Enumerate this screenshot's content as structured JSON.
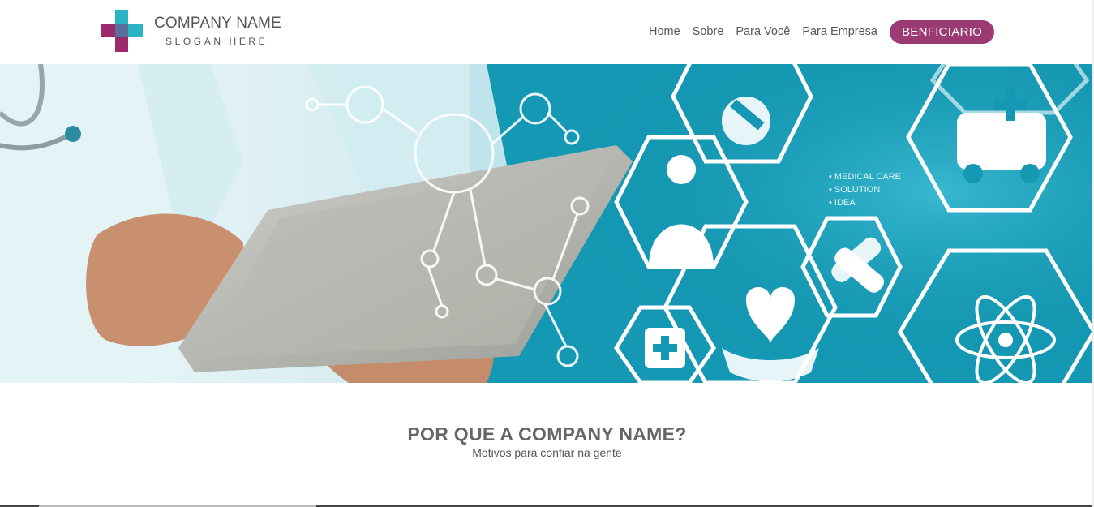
{
  "brand": {
    "name": "COMPANY NAME",
    "slogan": "SLOGAN HERE",
    "colors": {
      "teal": "#2ab3c2",
      "magenta": "#9c2a6c"
    }
  },
  "nav": {
    "items": [
      {
        "label": "Home"
      },
      {
        "label": "Sobre"
      },
      {
        "label": "Para Você"
      },
      {
        "label": "Para Empresa"
      }
    ],
    "cta_label": "BENFICIARIO",
    "cta_color": "#9c3a74"
  },
  "hero": {
    "image_text": [
      "• MEDICAL CARE",
      "• SOLUTION",
      "• IDEA"
    ]
  },
  "section": {
    "title": "POR QUE A COMPANY NAME?",
    "subtitle": "Motivos para confiar na gente"
  }
}
